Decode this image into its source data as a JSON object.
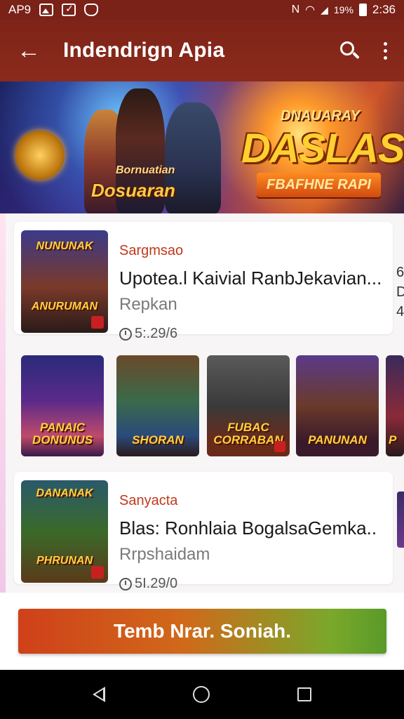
{
  "status_bar": {
    "carrier": "AP9",
    "battery_pct": "19%",
    "time": "2:36"
  },
  "app_bar": {
    "title": "Indendrign Apia",
    "back_icon": "arrow-left-icon",
    "search_icon": "search-icon",
    "more_icon": "more-vert-icon"
  },
  "banner": {
    "left_sub": "Bornuatian",
    "left_title": "Dosuaran",
    "right_top": "DNAUARAY",
    "right_main": "DASLASA",
    "right_ribbon": "FBAFHNE RAPI"
  },
  "feed": {
    "items": [
      {
        "thumb_logo_top": "NUNUNAK",
        "thumb_logo_bottom": "ANURUMAN",
        "category": "Sargmsao",
        "name": "Upotea.l Kaivial RanbJekavian...",
        "sub": "Repkan",
        "time": "5:.29/6"
      },
      {
        "thumb_logo_top": "DANANAK",
        "thumb_logo_bottom": "PHRUNAN",
        "category": "Sanyacta",
        "name": "Blas: Ronhlaia BogalsaGemka..",
        "sub": "Rrpshaidam",
        "time": "5I.29/0"
      }
    ],
    "peek_first": [
      "6",
      "D",
      "4"
    ],
    "tiles": [
      {
        "label": "PANAIC DONUNUS"
      },
      {
        "label": "SHORAN"
      },
      {
        "label": "FUBAC CORRABAN"
      },
      {
        "label": "PANUNAN"
      },
      {
        "label": "P"
      }
    ]
  },
  "cta": {
    "label": "Temb Nrar. Soniah."
  },
  "nav": {
    "back": "nav-back-icon",
    "home": "nav-home-icon",
    "recent": "nav-recent-icon"
  }
}
